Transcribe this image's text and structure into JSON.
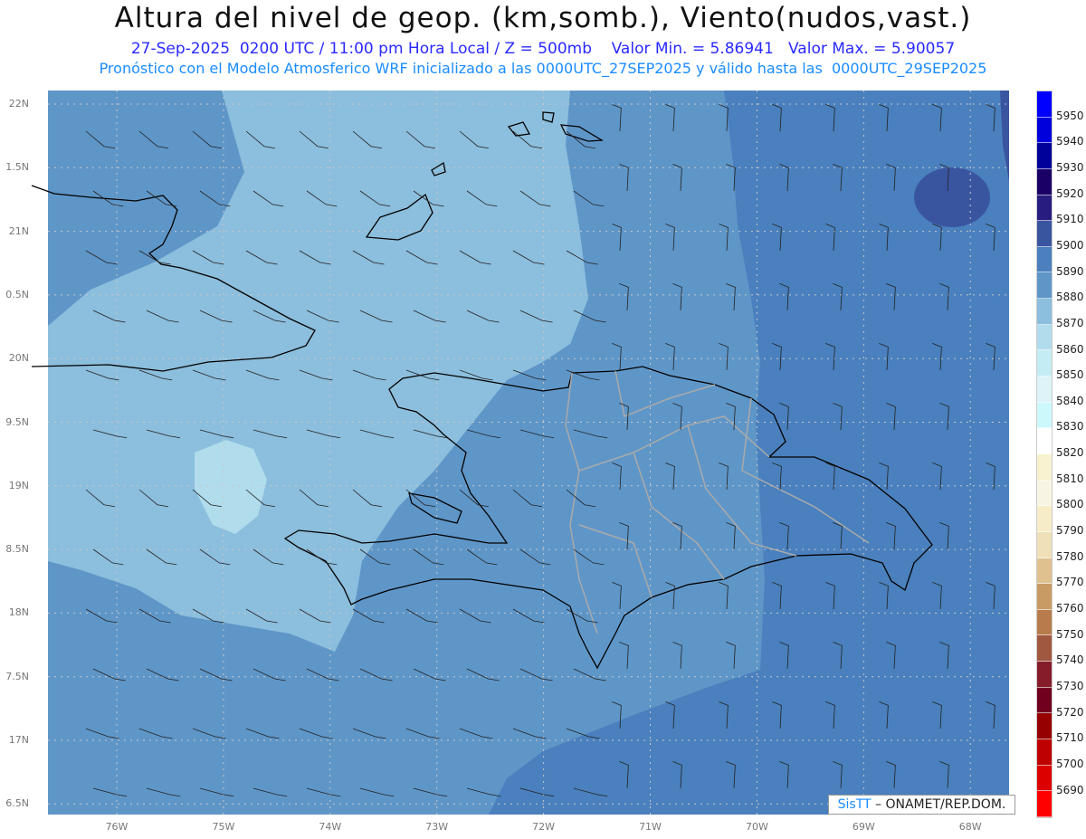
{
  "header": {
    "title": "Altura del nivel de geop. (km,somb.), Viento(nudos,vast.)",
    "subtitle": "27-Sep-2025  0200 UTC / 11:00 pm Hora Local / Z = 500mb    Valor Min. = 5.86941   Valor Max. = 5.90057",
    "info": "Pronóstico con el Modelo Atmosferico WRF inicializado a las 0000UTC_27SEP2025 y válido hasta las  0000UTC_29SEP2025"
  },
  "axes": {
    "lat_labels": [
      "22N",
      "1.5N",
      "21N",
      "0.5N",
      "20N",
      "9.5N",
      "19N",
      "8.5N",
      "18N",
      "7.5N",
      "17N",
      "6.5N"
    ],
    "lon_labels": [
      "76W",
      "75W",
      "74W",
      "73W",
      "72W",
      "71W",
      "70W",
      "69W",
      "68W"
    ]
  },
  "colorbar": {
    "labels": [
      "5950",
      "5940",
      "5930",
      "5920",
      "5910",
      "5900",
      "5890",
      "5880",
      "5870",
      "5860",
      "5850",
      "5840",
      "5830",
      "5820",
      "5810",
      "5800",
      "5790",
      "5780",
      "5770",
      "5760",
      "5750",
      "5740",
      "5730",
      "5720",
      "5710",
      "5700",
      "5690"
    ],
    "colors": [
      "#0000ff",
      "#0000dd",
      "#00009a",
      "#1a0066",
      "#281c80",
      "#3a55a0",
      "#4a80bd",
      "#5f96c8",
      "#8cbedd",
      "#b0dcec",
      "#c4ecf5",
      "#ddf3f8",
      "#ccf8fc",
      "#ffffff",
      "#f8f2d0",
      "#f8f4e4",
      "#f6edc8",
      "#f0e0b8",
      "#dfc190",
      "#c89a64",
      "#b87c4c",
      "#a05840",
      "#861c2a",
      "#70001e",
      "#960000",
      "#be0000",
      "#dc0000",
      "#ff0000"
    ]
  },
  "credit": {
    "logo": "SisTT",
    "text": " – ONAMET/REP.DOM."
  }
}
